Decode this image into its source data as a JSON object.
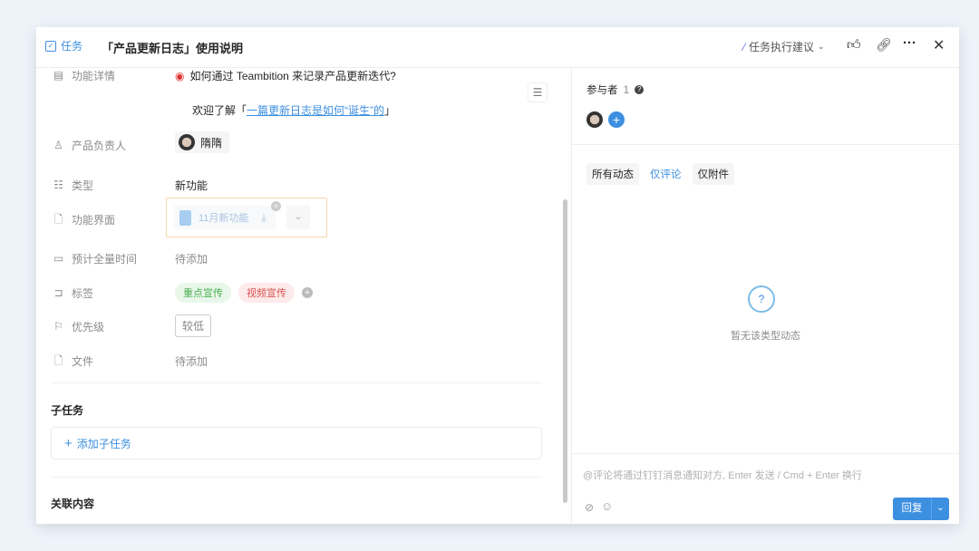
{
  "header": {
    "type_label": "任务",
    "title": "「产品更新日志」使用说明",
    "suggest_label": "任务执行建议"
  },
  "fields": {
    "detail": {
      "label": "功能详情",
      "line1": "如何通过 Teambition 来记录产品更新迭代?",
      "line2_prefix": "欢迎了解「",
      "link": "一篇更新日志是如何“诞生”的",
      "line2_suffix": "」"
    },
    "owner": {
      "label": "产品负责人",
      "value": "隋隋"
    },
    "type": {
      "label": "类型",
      "value": "新功能"
    },
    "ui": {
      "label": "功能界面",
      "file": "11月新功能"
    },
    "time": {
      "label": "预计全量时间",
      "value": "待添加"
    },
    "tags": {
      "label": "标签",
      "items": [
        "重点宣传",
        "视频宣传"
      ]
    },
    "priority": {
      "label": "优先级",
      "value": "较低"
    },
    "file": {
      "label": "文件",
      "value": "待添加"
    }
  },
  "subtasks": {
    "title": "子任务",
    "add_label": "添加子任务"
  },
  "related": {
    "title": "关联内容"
  },
  "participants": {
    "label": "参与者",
    "count": "1"
  },
  "activity_tabs": [
    "所有动态",
    "仅评论",
    "仅附件"
  ],
  "empty_text": "暂无该类型动态",
  "comment": {
    "placeholder": "@评论将通过钉钉消息通知对方, Enter 发送 / Cmd + Enter 换行",
    "reply_label": "回复"
  },
  "colors": {
    "accent": "#3d8fe0",
    "tag_green": "#e8f7ea",
    "tag_red": "#fdeaea"
  }
}
